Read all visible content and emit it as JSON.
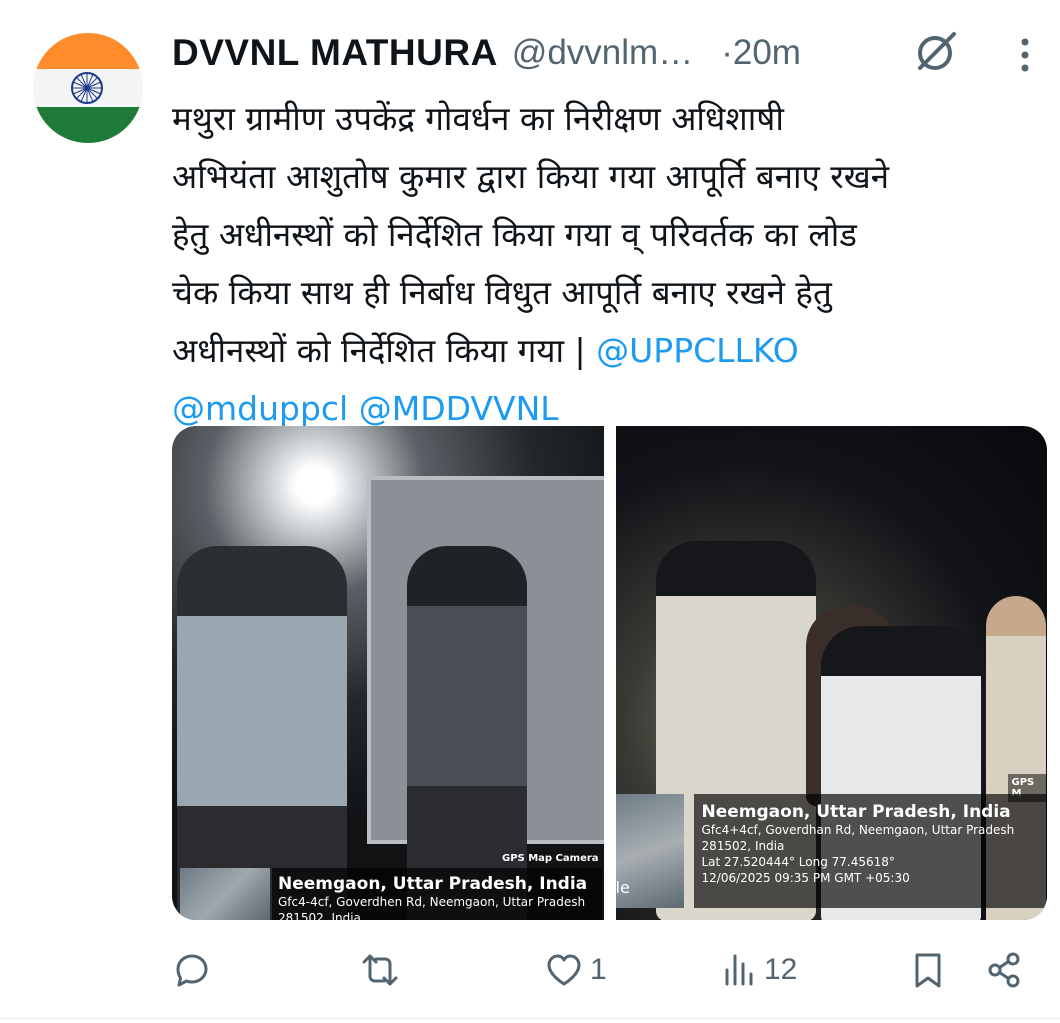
{
  "post": {
    "author_name": "DVVNL MATHURA",
    "handle": "@dvvnlm…",
    "time": "·20m",
    "text_lines": [
      "मथुरा ग्रामीण उपकेंद्र गोवर्धन का निरीक्षण अधिशाषी",
      "अभियंता आशुतोष कुमार द्वारा किया गया आपूर्ति बनाए रखने",
      "हेतु अधीनस्थों को निर्देशित किया गया व् परिवर्तक का लोड",
      "चेक किया साथ ही निर्बाध विधुत आपूर्ति बनाए रखने हेतु",
      "अधीनस्थों को निर्देशित किया गया | "
    ],
    "mentions": [
      "@UPPCLLKO",
      "@mduppcl",
      "@MDDVVNL"
    ]
  },
  "media": {
    "photo1": {
      "badge": "GPS Map Camera",
      "location": "Neemgaon, Uttar Pradesh, India",
      "address_line1": "Gfc4-4cf, Goverdhen Rd, Neemgaon, Uttar Pradesh",
      "address_line2": "281502, India"
    },
    "photo2": {
      "badge": "GPS M",
      "location": "Neemgaon, Uttar Pradesh, India",
      "address_line1": "Gfc4+4cf, Goverdhan Rd, Neemgaon, Uttar Pradesh",
      "address_line2": "281502, India",
      "latlong": "Lat 27.520444° Long 77.45618°",
      "datetime": "12/06/2025 09:35 PM GMT +05:30",
      "map_edge_text": "le"
    }
  },
  "actions": {
    "reply_count": "",
    "repost_count": "",
    "like_count": "1",
    "views_count": "12"
  },
  "icons": {
    "avatar": "india-flag-avatar",
    "grok": "grok-icon",
    "more": "more-vertical-icon",
    "reply": "reply-icon",
    "repost": "repost-icon",
    "like": "heart-icon",
    "views": "views-icon",
    "bookmark": "bookmark-icon",
    "share": "share-icon"
  },
  "colors": {
    "mention": "#1d9bf0",
    "secondary_text": "#536471",
    "primary_text": "#0f1419"
  }
}
